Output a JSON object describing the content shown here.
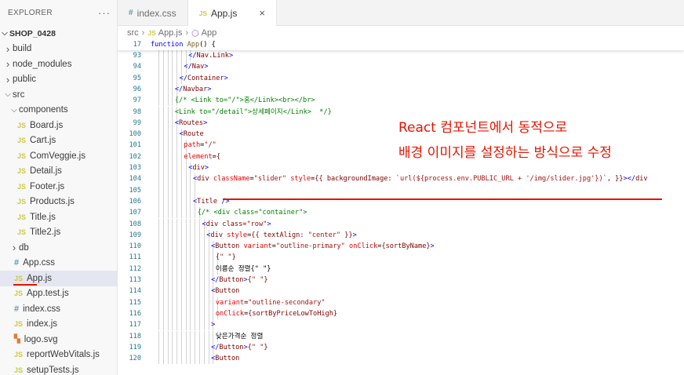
{
  "sidebar": {
    "title": "EXPLORER",
    "more": "···",
    "root": "SHOP_0428",
    "items": [
      {
        "label": "build",
        "kind": "folder",
        "depth": 1
      },
      {
        "label": "node_modules",
        "kind": "folder",
        "depth": 1
      },
      {
        "label": "public",
        "kind": "folder",
        "depth": 1
      },
      {
        "label": "src",
        "kind": "folder-open",
        "depth": 1
      },
      {
        "label": "components",
        "kind": "folder-open",
        "depth": 2
      },
      {
        "label": "Board.js",
        "kind": "js",
        "depth": 3
      },
      {
        "label": "Cart.js",
        "kind": "js",
        "depth": 3
      },
      {
        "label": "ComVeggie.js",
        "kind": "js",
        "depth": 3
      },
      {
        "label": "Detail.js",
        "kind": "js",
        "depth": 3
      },
      {
        "label": "Footer.js",
        "kind": "js",
        "depth": 3
      },
      {
        "label": "Products.js",
        "kind": "js",
        "depth": 3
      },
      {
        "label": "Title.js",
        "kind": "js",
        "depth": 3
      },
      {
        "label": "Title2.js",
        "kind": "js",
        "depth": 3
      },
      {
        "label": "db",
        "kind": "folder",
        "depth": 2
      },
      {
        "label": "App.css",
        "kind": "css",
        "depth": 2
      },
      {
        "label": "App.js",
        "kind": "js",
        "depth": 2
      },
      {
        "label": "App.test.js",
        "kind": "js",
        "depth": 2
      },
      {
        "label": "index.css",
        "kind": "css",
        "depth": 2
      },
      {
        "label": "index.js",
        "kind": "js",
        "depth": 2
      },
      {
        "label": "logo.svg",
        "kind": "svg",
        "depth": 2
      },
      {
        "label": "reportWebVitals.js",
        "kind": "js",
        "depth": 2
      },
      {
        "label": "setupTests.js",
        "kind": "js",
        "depth": 2
      }
    ]
  },
  "tabs": [
    {
      "icon": "#",
      "label": "index.css",
      "active": false
    },
    {
      "icon": "JS",
      "label": "App.js",
      "active": true,
      "close": "×"
    }
  ],
  "breadcrumb": {
    "folder": "src",
    "file": "App.js",
    "symbol": "App"
  },
  "sticky": {
    "ln": "17",
    "code": "function App() {"
  },
  "lines": [
    {
      "ln": "93",
      "code": "</Nav.Link>"
    },
    {
      "ln": "94",
      "code": "</Nav>"
    },
    {
      "ln": "95",
      "code": "</Container>"
    },
    {
      "ln": "96",
      "code": "</Navbar>"
    },
    {
      "ln": "97",
      "code": "{/* <Link to=\"/\">홈</Link><br></br>"
    },
    {
      "ln": "98",
      "code": "<Link to=\"/detail\">상세페이지</Link>  */}"
    },
    {
      "ln": "99",
      "code": "<Routes>"
    },
    {
      "ln": "100",
      "code": "<Route"
    },
    {
      "ln": "101",
      "code": "path=\"/\""
    },
    {
      "ln": "102",
      "code": "element={"
    },
    {
      "ln": "103",
      "code": "<div>"
    },
    {
      "ln": "104",
      "code": "<div className=\"slider\" style={{ backgroundImage: `url(${process.env.PUBLIC_URL + '/img/slider.jpg'})`, }}></div"
    },
    {
      "ln": "105",
      "code": ""
    },
    {
      "ln": "106",
      "code": "<Title />"
    },
    {
      "ln": "107",
      "code": "{/* <div class=\"container\">"
    },
    {
      "ln": "108",
      "code": "<div class=\"row\">"
    },
    {
      "ln": "109",
      "code": "<div style={{ textAlign: \"center\" }}>"
    },
    {
      "ln": "110",
      "code": "<Button variant=\"outline-primary\" onClick={sortByName}>"
    },
    {
      "ln": "111",
      "code": "{\" \"}"
    },
    {
      "ln": "112",
      "code": "이름순 정렬{\" \"}"
    },
    {
      "ln": "113",
      "code": "</Button>{\" \"}"
    },
    {
      "ln": "114",
      "code": "<Button"
    },
    {
      "ln": "115",
      "code": "variant=\"outline-secondary\""
    },
    {
      "ln": "116",
      "code": "onClick={sortByPriceLowToHigh}"
    },
    {
      "ln": "117",
      "code": ">"
    },
    {
      "ln": "118",
      "code": "낮은가격순 정렬"
    },
    {
      "ln": "119",
      "code": "</Button>{\" \"}"
    },
    {
      "ln": "120",
      "code": "<Button"
    }
  ],
  "annotation": {
    "line1": "React 컴포넌트에서 동적으로",
    "line2": "배경 이미지를 설정하는 방식으로 수정"
  },
  "colors": {
    "annotation": "#e51400",
    "line_number": "#237893",
    "keyword": "#0000ff",
    "tag": "#800000",
    "attr": "#e50000",
    "string": "#a31515"
  }
}
